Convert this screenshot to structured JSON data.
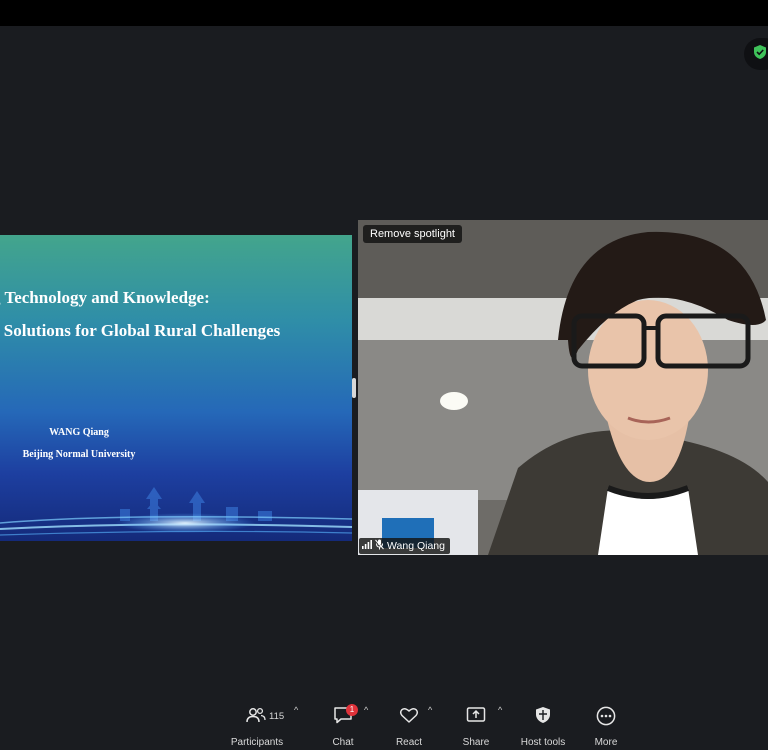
{
  "slide": {
    "title_line1": "g Technology and Knowledge:",
    "title_line2": "e Solutions for Global Rural Challenges",
    "author": "WANG Qiang",
    "affiliation": "Beijing Normal University"
  },
  "video": {
    "spotlight_button": "Remove spotlight",
    "participant_name": "Wang Qiang"
  },
  "toolbar": {
    "participants": {
      "label": "Participants",
      "count": "115"
    },
    "chat": {
      "label": "Chat",
      "badge": "1"
    },
    "react": {
      "label": "React"
    },
    "share": {
      "label": "Share"
    },
    "host_tools": {
      "label": "Host tools"
    },
    "more": {
      "label": "More"
    }
  },
  "colors": {
    "background": "#1a1c20",
    "security_green": "#3fc25a",
    "badge_red": "#e0323a"
  },
  "icons": [
    "shield-check-icon",
    "participants-icon",
    "chat-icon",
    "heart-icon",
    "share-screen-icon",
    "host-shield-icon",
    "more-icon",
    "signal-icon",
    "mic-muted-icon",
    "chevron-up-icon"
  ]
}
